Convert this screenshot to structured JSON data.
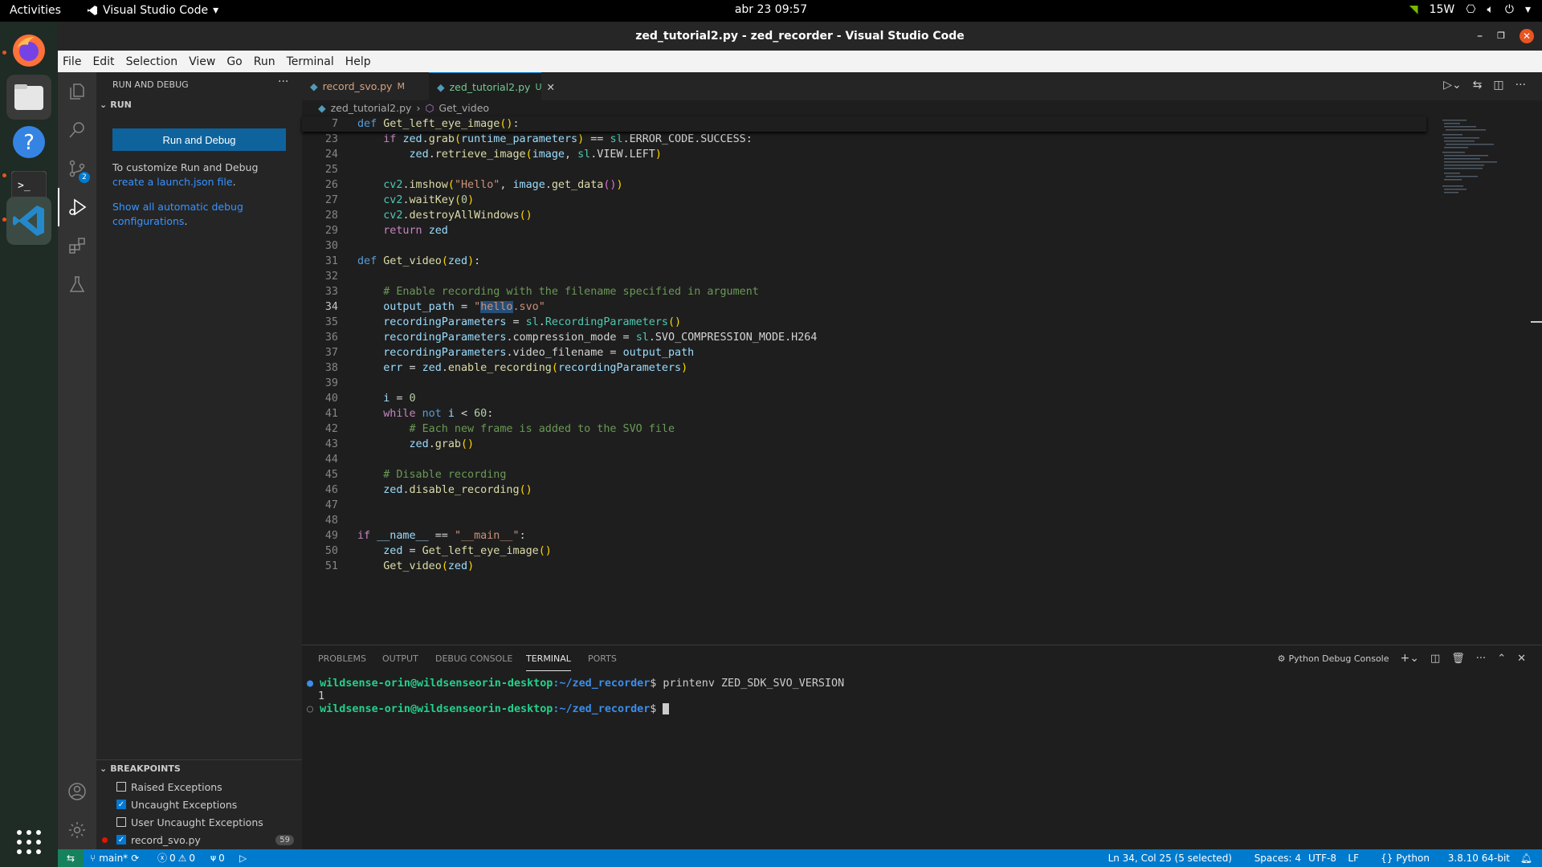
{
  "topbar": {
    "activities": "Activities",
    "app_name": "Visual Studio Code",
    "clock": "abr 23  09:57",
    "power": "15W"
  },
  "window": {
    "title": "zed_tutorial2.py - zed_recorder - Visual Studio Code"
  },
  "menu": [
    "File",
    "Edit",
    "Selection",
    "View",
    "Go",
    "Run",
    "Terminal",
    "Help"
  ],
  "activitybar": {
    "scm_badge": "2"
  },
  "sidebar": {
    "title": "RUN AND DEBUG",
    "section": "RUN",
    "run_button": "Run and Debug",
    "customize_text": "To customize Run and Debug ",
    "create_link": "create a launch.json file",
    "show_all_link": "Show all automatic debug configurations",
    "breakpoints_title": "BREAKPOINTS",
    "breakpoints": [
      {
        "label": "Raised Exceptions",
        "checked": false
      },
      {
        "label": "Uncaught Exceptions",
        "checked": true
      },
      {
        "label": "User Uncaught Exceptions",
        "checked": false
      },
      {
        "label": "record_svo.py",
        "checked": true,
        "line": "59"
      }
    ]
  },
  "tabs": [
    {
      "label": "record_svo.py",
      "status": "M",
      "active": false
    },
    {
      "label": "zed_tutorial2.py",
      "status": "U",
      "active": true
    }
  ],
  "breadcrumb": {
    "file": "zed_tutorial2.py",
    "symbol": "Get_video"
  },
  "editor": {
    "current_line": 34,
    "lines": [
      7,
      23,
      24,
      25,
      26,
      27,
      28,
      29,
      30,
      31,
      32,
      33,
      34,
      35,
      36,
      37,
      38,
      39,
      40,
      41,
      42,
      43,
      44,
      45,
      46,
      47,
      48,
      49,
      50,
      51
    ]
  },
  "panel": {
    "tabs": [
      "PROBLEMS",
      "OUTPUT",
      "DEBUG CONSOLE",
      "TERMINAL",
      "PORTS"
    ],
    "active_tab": "TERMINAL",
    "terminal_name": "Python Debug Console",
    "terminal": {
      "prompt_user": "wildsense-orin@wildsenseorin-desktop",
      "prompt_path": ":~/zed_recorder",
      "command": "$ printenv ZED_SDK_SVO_VERSION",
      "output": "1",
      "prompt_end": "$ "
    }
  },
  "statusbar": {
    "branch": "main*",
    "errors": "0",
    "warnings": "0",
    "ports": "0",
    "position": "Ln 34, Col 25 (5 selected)",
    "spaces": "Spaces: 4",
    "encoding": "UTF-8",
    "eol": "LF",
    "language": "Python",
    "interpreter": "3.8.10 64-bit"
  },
  "colors": {
    "accent": "#007acc",
    "button": "#0e639c",
    "prompt_green": "#23d18b",
    "path_blue": "#3b8eea"
  }
}
